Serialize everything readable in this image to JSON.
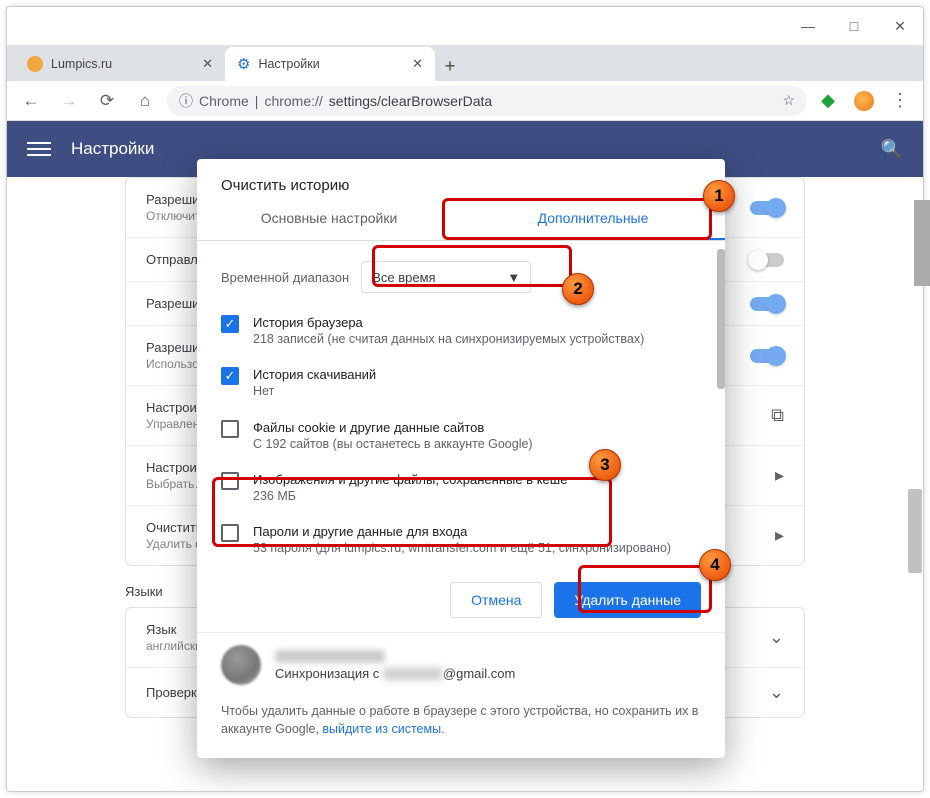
{
  "window": {
    "minimize": "—",
    "maximize": "□",
    "close": "✕"
  },
  "tabs": {
    "items": [
      {
        "title": "Lumpics.ru"
      },
      {
        "title": "Настройки"
      }
    ]
  },
  "addr": {
    "lock": "ⓘ",
    "scheme": "Chrome",
    "sep": " | ",
    "host": "chrome://",
    "path": "settings/clearBrowserData",
    "star": "☆"
  },
  "settings": {
    "title": "Настройки",
    "rows": [
      {
        "t": "Разрешить…",
        "s": "Отключите эту функцию, если она не нужна (необходимо…)"
      },
      {
        "t": "Отправлять…",
        "s": ""
      },
      {
        "t": "Разрешить…",
        "s": ""
      },
      {
        "t": "Разрешить…",
        "s": "Использовать… открывает…"
      },
      {
        "t": "Настроить…",
        "s": "Управление…"
      },
      {
        "t": "Настроить…",
        "s": "Выбрать…"
      },
      {
        "t": "Очистить…",
        "s": "Удалить файлы…"
      }
    ],
    "section_lang": "Языки",
    "lang_row": {
      "t": "Язык",
      "s": "английский"
    },
    "spell_row": {
      "t": "Проверка правописания"
    }
  },
  "dialog": {
    "title": "Очистить историю",
    "tab_basic": "Основные настройки",
    "tab_adv": "Дополнительные",
    "range_label": "Временной диапазон",
    "range_value": "Все время",
    "items": [
      {
        "checked": true,
        "t1": "История браузера",
        "t2": "218 записей (не считая данных на синхронизируемых устройствах)"
      },
      {
        "checked": true,
        "t1": "История скачиваний",
        "t2": "Нет"
      },
      {
        "checked": false,
        "t1": "Файлы cookie и другие данные сайтов",
        "t2": "С 192 сайтов (вы останетесь в аккаунте Google)"
      },
      {
        "checked": false,
        "t1": "Изображения и другие файлы, сохраненные в кеше",
        "t2": "236 МБ"
      },
      {
        "checked": false,
        "t1": "Пароли и другие данные для входа",
        "t2": "53 пароля (для lumpics.ru, wmtransfer.com и ещё 51, синхронизировано)"
      }
    ],
    "cancel": "Отмена",
    "confirm": "Удалить данные",
    "sync_label": "Синхронизация с ",
    "sync_mail_suffix": "@gmail.com",
    "note_1": "Чтобы удалить данные о работе в браузере с этого устройства, но сохранить их в аккаунте Google, ",
    "note_link": "выйдите из системы",
    "note_2": "."
  },
  "badges": {
    "1": "1",
    "2": "2",
    "3": "3",
    "4": "4"
  }
}
